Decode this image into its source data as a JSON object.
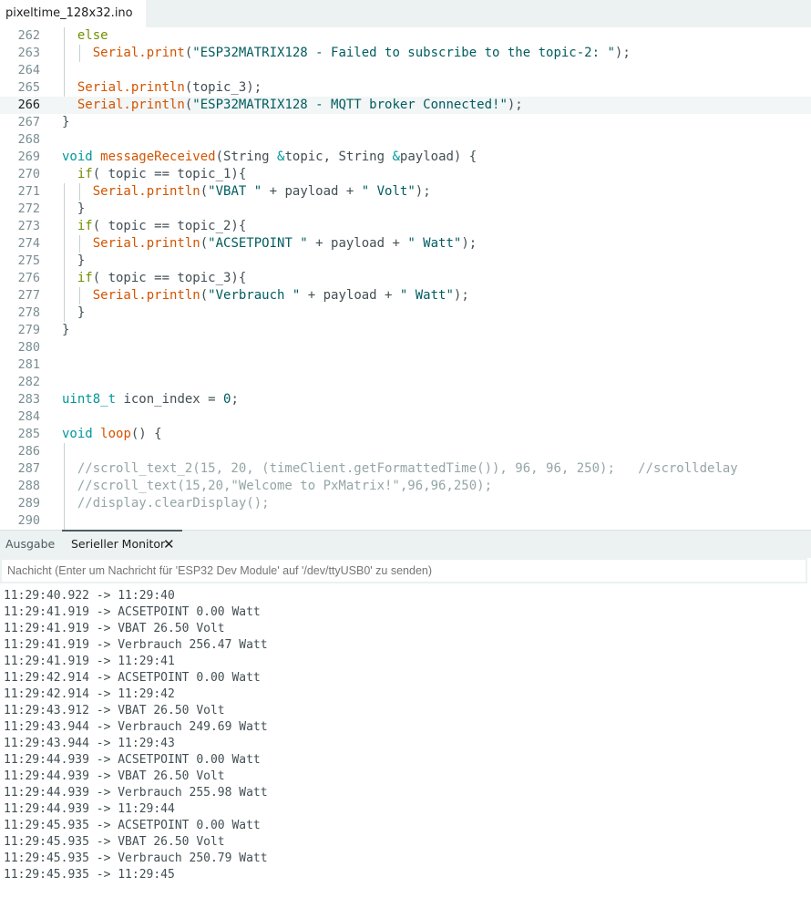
{
  "file_tab": {
    "name": "pixeltime_128x32.ino"
  },
  "editor": {
    "current_line": "266",
    "lines": [
      {
        "n": "262",
        "tokens": [
          [
            "kw",
            "  else"
          ]
        ]
      },
      {
        "n": "263",
        "tokens": [
          [
            "fn",
            "    Serial.print"
          ],
          [
            "p",
            "("
          ],
          [
            "str",
            "\"ESP32MATRIX128 - Failed to subscribe to the topic-2: \""
          ],
          [
            "p",
            ");"
          ]
        ]
      },
      {
        "n": "264",
        "tokens": []
      },
      {
        "n": "265",
        "tokens": [
          [
            "fn",
            "  Serial.println"
          ],
          [
            "p",
            "(topic_3);"
          ]
        ]
      },
      {
        "n": "266",
        "tokens": [
          [
            "fn",
            "  Serial.println"
          ],
          [
            "p",
            "("
          ],
          [
            "str",
            "\"ESP32MATRIX128 - MQTT broker Connected!\""
          ],
          [
            "p",
            ");"
          ]
        ]
      },
      {
        "n": "267",
        "tokens": [
          [
            "p",
            "}"
          ]
        ]
      },
      {
        "n": "268",
        "tokens": []
      },
      {
        "n": "269",
        "tokens": [
          [
            "type",
            "void "
          ],
          [
            "fn",
            "messageReceived"
          ],
          [
            "p",
            "(String "
          ],
          [
            "type",
            "&"
          ],
          [
            "p",
            "topic, String "
          ],
          [
            "type",
            "&"
          ],
          [
            "p",
            "payload) {"
          ]
        ]
      },
      {
        "n": "270",
        "tokens": [
          [
            "kw",
            "  if"
          ],
          [
            "p",
            "( topic == topic_1){"
          ]
        ]
      },
      {
        "n": "271",
        "tokens": [
          [
            "fn",
            "    Serial.println"
          ],
          [
            "p",
            "("
          ],
          [
            "str",
            "\"VBAT \""
          ],
          [
            "p",
            " + payload + "
          ],
          [
            "str",
            "\" Volt\""
          ],
          [
            "p",
            ");"
          ]
        ]
      },
      {
        "n": "272",
        "tokens": [
          [
            "p",
            "  }"
          ]
        ]
      },
      {
        "n": "273",
        "tokens": [
          [
            "kw",
            "  if"
          ],
          [
            "p",
            "( topic == topic_2){"
          ]
        ]
      },
      {
        "n": "274",
        "tokens": [
          [
            "fn",
            "    Serial.println"
          ],
          [
            "p",
            "("
          ],
          [
            "str",
            "\"ACSETPOINT \""
          ],
          [
            "p",
            " + payload + "
          ],
          [
            "str",
            "\" Watt\""
          ],
          [
            "p",
            ");"
          ]
        ]
      },
      {
        "n": "275",
        "tokens": [
          [
            "p",
            "  }"
          ]
        ]
      },
      {
        "n": "276",
        "tokens": [
          [
            "kw",
            "  if"
          ],
          [
            "p",
            "( topic == topic_3){"
          ]
        ]
      },
      {
        "n": "277",
        "tokens": [
          [
            "fn",
            "    Serial.println"
          ],
          [
            "p",
            "("
          ],
          [
            "str",
            "\"Verbrauch \""
          ],
          [
            "p",
            " + payload + "
          ],
          [
            "str",
            "\" Watt\""
          ],
          [
            "p",
            ");"
          ]
        ]
      },
      {
        "n": "278",
        "tokens": [
          [
            "p",
            "  }"
          ]
        ]
      },
      {
        "n": "279",
        "tokens": [
          [
            "p",
            "}"
          ]
        ]
      },
      {
        "n": "280",
        "tokens": []
      },
      {
        "n": "281",
        "tokens": []
      },
      {
        "n": "282",
        "tokens": []
      },
      {
        "n": "283",
        "tokens": [
          [
            "type",
            "uint8_t"
          ],
          [
            "p",
            " icon_index = "
          ],
          [
            "num",
            "0"
          ],
          [
            "p",
            ";"
          ]
        ]
      },
      {
        "n": "284",
        "tokens": []
      },
      {
        "n": "285",
        "tokens": [
          [
            "type",
            "void "
          ],
          [
            "fn",
            "loop"
          ],
          [
            "p",
            "() {"
          ]
        ]
      },
      {
        "n": "286",
        "tokens": []
      },
      {
        "n": "287",
        "tokens": [
          [
            "cm",
            "  //scroll_text_2(15, 20, (timeClient.getFormattedTime()), 96, 96, 250);   //scrolldelay"
          ]
        ]
      },
      {
        "n": "288",
        "tokens": [
          [
            "cm",
            "  //scroll_text(15,20,\"Welcome to PxMatrix!\",96,96,250);"
          ]
        ]
      },
      {
        "n": "289",
        "tokens": [
          [
            "cm",
            "  //display.clearDisplay();"
          ]
        ]
      },
      {
        "n": "290",
        "tokens": []
      }
    ]
  },
  "panel": {
    "tabs": [
      {
        "label": "Ausgabe",
        "active": false
      },
      {
        "label": "Serieller Monitor",
        "active": true
      }
    ],
    "close_icon": "close-icon",
    "input_placeholder": "Nachicht (Enter um Nachricht für 'ESP32 Dev Module' auf '/dev/ttyUSB0' zu senden)"
  },
  "serial_monitor": {
    "lines": [
      "11:29:40.922 -> 11:29:40",
      "11:29:41.919 -> ACSETPOINT 0.00 Watt",
      "11:29:41.919 -> VBAT 26.50 Volt",
      "11:29:41.919 -> Verbrauch 256.47 Watt",
      "11:29:41.919 -> 11:29:41",
      "11:29:42.914 -> ACSETPOINT 0.00 Watt",
      "11:29:42.914 -> 11:29:42",
      "11:29:43.912 -> VBAT 26.50 Volt",
      "11:29:43.944 -> Verbrauch 249.69 Watt",
      "11:29:43.944 -> 11:29:43",
      "11:29:44.939 -> ACSETPOINT 0.00 Watt",
      "11:29:44.939 -> VBAT 26.50 Volt",
      "11:29:44.939 -> Verbrauch 255.98 Watt",
      "11:29:44.939 -> 11:29:44",
      "11:29:45.935 -> ACSETPOINT 0.00 Watt",
      "11:29:45.935 -> VBAT 26.50 Volt",
      "11:29:45.935 -> Verbrauch 250.79 Watt",
      "11:29:45.935 -> 11:29:45"
    ]
  },
  "colors": {
    "keyword": "#728e00",
    "function": "#d35400",
    "string": "#005c5f",
    "type": "#00979c",
    "comment": "#95a5a6"
  }
}
